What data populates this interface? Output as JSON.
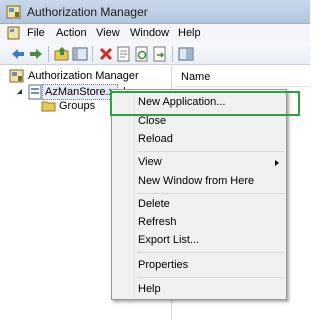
{
  "window": {
    "title": "Authorization Manager"
  },
  "menubar": {
    "items": [
      "File",
      "Action",
      "View",
      "Window",
      "Help"
    ]
  },
  "toolbar": {
    "buttons": [
      "back-icon",
      "forward-icon",
      "up-folder-icon",
      "show-hide-tree-icon",
      "delete-icon",
      "properties-icon",
      "refresh-icon",
      "export-icon",
      "help-icon"
    ]
  },
  "tree": {
    "root": "Authorization Manager",
    "store": "AzManStore.xml",
    "groups": "Groups"
  },
  "list": {
    "column_name": "Name"
  },
  "context_menu": {
    "items": [
      "New Application...",
      "Close",
      "Reload",
      "View",
      "New Window from Here",
      "Delete",
      "Refresh",
      "Export List...",
      "Properties",
      "Help"
    ],
    "highlighted": "New Application..."
  },
  "colors": {
    "highlight_outline": "#2ea043",
    "titlebar": "#c9d7ea"
  }
}
